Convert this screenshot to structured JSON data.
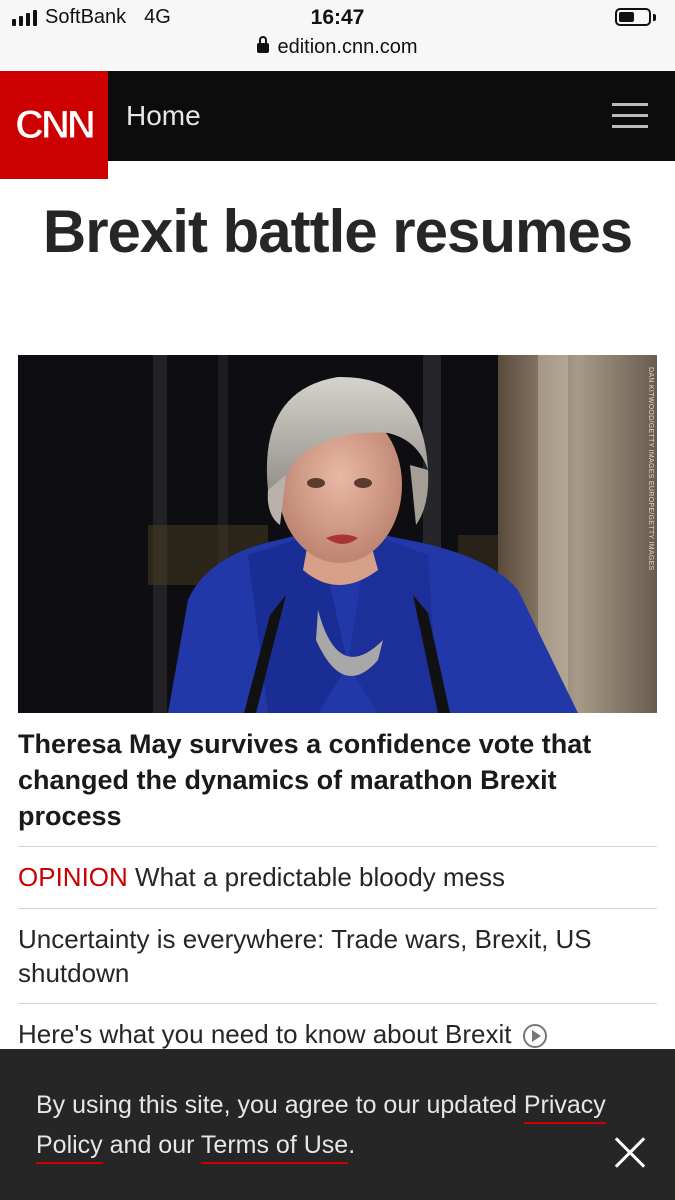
{
  "status_bar": {
    "carrier": "SoftBank",
    "network": "4G",
    "time": "16:47",
    "url": "edition.cnn.com"
  },
  "header": {
    "logo": "CNN",
    "section": "Home",
    "menu_icon": "hamburger-menu-icon"
  },
  "main": {
    "headline": "Brexit battle resumes",
    "image_credit": "DAN KITWOOD/GETTY IMAGES EUROPE/GETTY IMAGES",
    "story_title": "Theresa May survives a confidence vote that changed the dynamics of marathon Brexit process",
    "links": [
      {
        "tag": "OPINION",
        "text": "What a predictable bloody mess"
      },
      {
        "text": "Uncertainty is everywhere: Trade wars, Brexit, US shutdown"
      },
      {
        "text": "Here's what you need to know about Brexit"
      }
    ]
  },
  "consent": {
    "text_1": "By using this site, you agree to our updated ",
    "privacy_link": "Privacy Policy",
    "text_2": " and our ",
    "terms_link": "Terms of Use",
    "text_3": "."
  },
  "colors": {
    "brand_red": "#cc0000",
    "header_bg": "#0c0c0c",
    "consent_bg": "#262626"
  }
}
